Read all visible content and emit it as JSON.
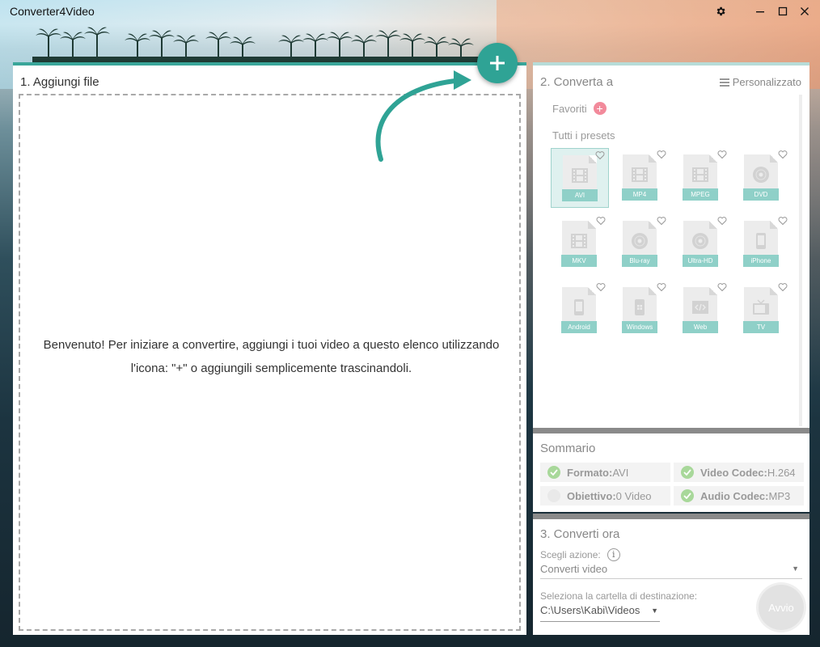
{
  "window": {
    "title": "Converter4Video",
    "settings_icon": "gear-icon",
    "minimize_icon": "minimize-icon",
    "maximize_icon": "maximize-icon",
    "close_icon": "close-icon"
  },
  "add_files": {
    "heading": "1. Aggiungi file",
    "welcome_line1": "Benvenuto! Per iniziare a convertire, aggiungi i tuoi video a questo elenco utilizzando",
    "welcome_line2": "l'icona: \"+\" o aggiungili semplicemente trascinandoli.",
    "add_button_icon": "plus-icon",
    "accent": "#2fa395"
  },
  "convert_to": {
    "heading": "2. Converta a",
    "custom_label": "Personalizzato",
    "favorites_label": "Favoriti",
    "all_presets_label": "Tutti i presets",
    "selected": "AVI",
    "presets": [
      {
        "label": "AVI",
        "icon": "film-icon"
      },
      {
        "label": "MP4",
        "icon": "film-icon"
      },
      {
        "label": "MPEG",
        "icon": "film-icon"
      },
      {
        "label": "DVD",
        "icon": "disc-icon"
      },
      {
        "label": "MKV",
        "icon": "film-icon"
      },
      {
        "label": "Blu-ray",
        "icon": "disc-icon"
      },
      {
        "label": "Ultra-HD",
        "icon": "disc-icon"
      },
      {
        "label": "iPhone",
        "icon": "phone-icon"
      },
      {
        "label": "Android",
        "icon": "phone-icon"
      },
      {
        "label": "Windows",
        "icon": "windows-icon"
      },
      {
        "label": "Web",
        "icon": "code-icon"
      },
      {
        "label": "TV",
        "icon": "tv-icon"
      }
    ]
  },
  "summary": {
    "heading": "Sommario",
    "items": [
      {
        "key": "Formato:",
        "value": "AVI",
        "checked": true
      },
      {
        "key": "Video Codec:",
        "value": "H.264",
        "checked": true
      },
      {
        "key": "Obiettivo:",
        "value": "0 Video",
        "checked": false
      },
      {
        "key": "Audio Codec:",
        "value": "MP3",
        "checked": true
      }
    ]
  },
  "convert_now": {
    "heading": "3. Converti ora",
    "action_label": "Scegli azione:",
    "action_value": "Converti video",
    "dest_label": "Seleziona la cartella di destinazione:",
    "dest_value": "C:\\Users\\Kabi\\Videos",
    "start_label": "Avvio"
  }
}
